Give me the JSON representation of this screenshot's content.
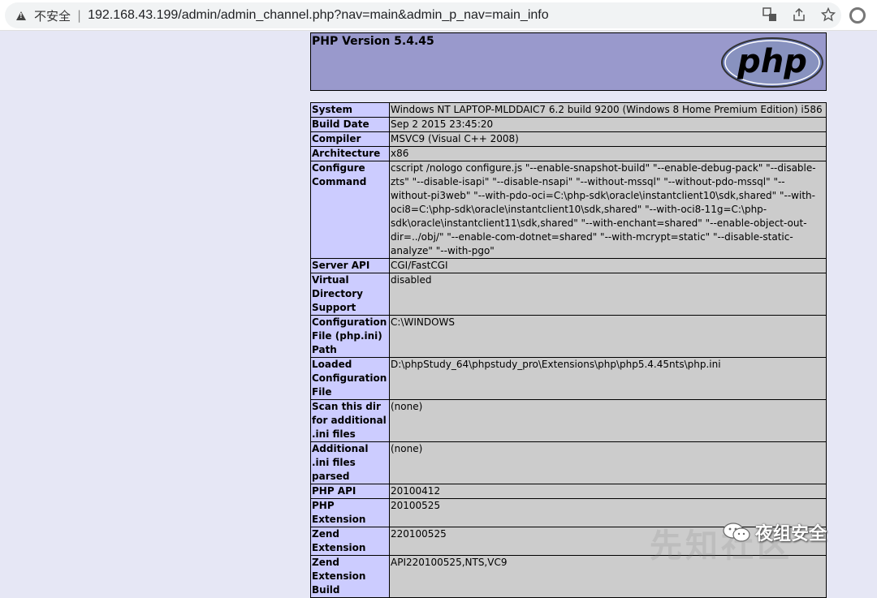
{
  "browser": {
    "insecure_label": "不安全",
    "separator": "|",
    "url": "192.168.43.199/admin/admin_channel.php?nav=main&admin_p_nav=main_info"
  },
  "phpinfo": {
    "title": "PHP Version 5.4.45",
    "logo_text": "php",
    "rows": [
      {
        "key": "System",
        "value": "Windows NT LAPTOP-MLDDAIC7 6.2 build 9200 (Windows 8 Home Premium Edition) i586"
      },
      {
        "key": "Build Date",
        "value": "Sep 2 2015 23:45:20"
      },
      {
        "key": "Compiler",
        "value": "MSVC9 (Visual C++ 2008)"
      },
      {
        "key": "Architecture",
        "value": "x86"
      },
      {
        "key": "Configure Command",
        "value": "cscript /nologo configure.js \"--enable-snapshot-build\" \"--enable-debug-pack\" \"--disable-zts\" \"--disable-isapi\" \"--disable-nsapi\" \"--without-mssql\" \"--without-pdo-mssql\" \"--without-pi3web\" \"--with-pdo-oci=C:\\php-sdk\\oracle\\instantclient10\\sdk,shared\" \"--with-oci8=C:\\php-sdk\\oracle\\instantclient10\\sdk,shared\" \"--with-oci8-11g=C:\\php-sdk\\oracle\\instantclient11\\sdk,shared\" \"--with-enchant=shared\" \"--enable-object-out-dir=../obj/\" \"--enable-com-dotnet=shared\" \"--with-mcrypt=static\" \"--disable-static-analyze\" \"--with-pgo\""
      },
      {
        "key": "Server API",
        "value": "CGI/FastCGI"
      },
      {
        "key": "Virtual Directory Support",
        "value": "disabled"
      },
      {
        "key": "Configuration File (php.ini) Path",
        "value": "C:\\WINDOWS"
      },
      {
        "key": "Loaded Configuration File",
        "value": "D:\\phpStudy_64\\phpstudy_pro\\Extensions\\php\\php5.4.45nts\\php.ini"
      },
      {
        "key": "Scan this dir for additional .ini files",
        "value": "(none)"
      },
      {
        "key": "Additional .ini files parsed",
        "value": "(none)"
      },
      {
        "key": "PHP API",
        "value": "20100412"
      },
      {
        "key": "PHP Extension",
        "value": "20100525"
      },
      {
        "key": "Zend Extension",
        "value": "220100525"
      },
      {
        "key": "Zend Extension Build",
        "value": "API220100525,NTS,VC9"
      }
    ]
  },
  "watermark": {
    "text": "夜组安全",
    "bg_text": "先知社区"
  }
}
